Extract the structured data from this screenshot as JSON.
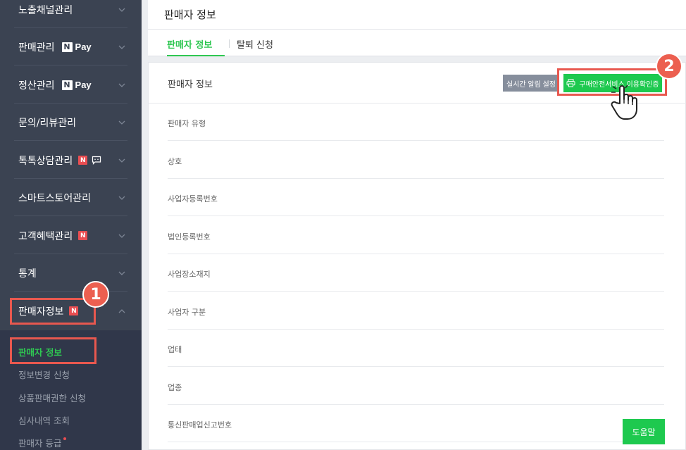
{
  "sidebar": {
    "items": [
      {
        "label": "노출채널관리"
      },
      {
        "label": "판매관리",
        "npay": "Pay",
        "npay_n": "N"
      },
      {
        "label": "정산관리",
        "npay": "Pay",
        "npay_n": "N"
      },
      {
        "label": "문의/리뷰관리"
      },
      {
        "label": "톡톡상담관리",
        "new_badge": "N"
      },
      {
        "label": "스마트스토어관리"
      },
      {
        "label": "고객혜택관리",
        "new_badge": "N"
      },
      {
        "label": "통계"
      },
      {
        "label": "판매자정보",
        "new_badge": "N"
      }
    ],
    "submenu": [
      {
        "label": "판매자 정보",
        "active": true
      },
      {
        "label": "정보변경 신청"
      },
      {
        "label": "상품판매권한 신청"
      },
      {
        "label": "심사내역 조회"
      },
      {
        "label": "판매자 등급"
      }
    ]
  },
  "header": {
    "title": "판매자 정보"
  },
  "tabs": [
    {
      "label": "판매자 정보",
      "active": true
    },
    {
      "label": "탈퇴 신청"
    }
  ],
  "panel": {
    "title": "판매자 정보",
    "realtime_button": "실시간 알림 설정",
    "verify_button": "구매안전서비스 이용확인증",
    "rows": [
      "판매자 유형",
      "상호",
      "사업자등록번호",
      "법인등록번호",
      "사업장소재지",
      "사업자 구분",
      "업태",
      "업종",
      "통신판매업신고번호"
    ],
    "help_button": "도움말"
  },
  "annotations": {
    "step1": "1",
    "step2": "2"
  },
  "colors": {
    "sidebar_bg": "#3b4352",
    "accent_green": "#1ec94f",
    "highlight_red": "#e8584f"
  }
}
